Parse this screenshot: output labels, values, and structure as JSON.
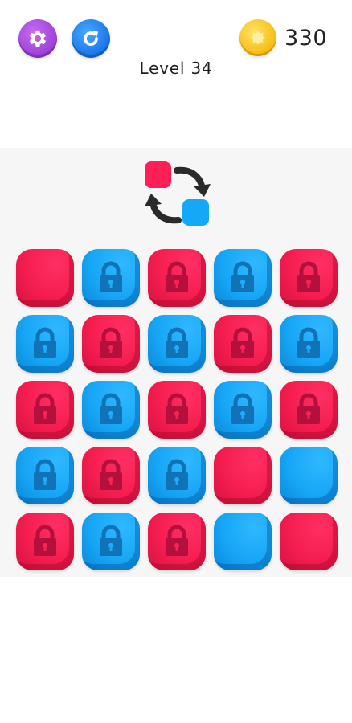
{
  "header": {
    "settings_icon": "gear-icon",
    "restart_icon": "restart-icon",
    "coin_icon": "coin-icon",
    "coins": "330",
    "level_text": "Level 34"
  },
  "hint": {
    "icon": "swap-arrows-icon",
    "from_color": "#ff1f55",
    "to_color": "#14a9f7"
  },
  "colors": {
    "red": "#f51d50",
    "blue": "#17a6f6",
    "settings_button": "#9b3fd6",
    "restart_button": "#1a73e8",
    "coin": "#f7c21b"
  },
  "board": {
    "rows": 5,
    "cols": 5,
    "tiles": [
      {
        "color": "red",
        "locked": false
      },
      {
        "color": "blue",
        "locked": true
      },
      {
        "color": "red",
        "locked": true
      },
      {
        "color": "blue",
        "locked": true
      },
      {
        "color": "red",
        "locked": true
      },
      {
        "color": "blue",
        "locked": true
      },
      {
        "color": "red",
        "locked": true
      },
      {
        "color": "blue",
        "locked": true
      },
      {
        "color": "red",
        "locked": true
      },
      {
        "color": "blue",
        "locked": true
      },
      {
        "color": "red",
        "locked": true
      },
      {
        "color": "blue",
        "locked": true
      },
      {
        "color": "red",
        "locked": true
      },
      {
        "color": "blue",
        "locked": true
      },
      {
        "color": "red",
        "locked": true
      },
      {
        "color": "blue",
        "locked": true
      },
      {
        "color": "red",
        "locked": true
      },
      {
        "color": "blue",
        "locked": true
      },
      {
        "color": "red",
        "locked": false
      },
      {
        "color": "blue",
        "locked": false
      },
      {
        "color": "red",
        "locked": true
      },
      {
        "color": "blue",
        "locked": true
      },
      {
        "color": "red",
        "locked": true
      },
      {
        "color": "blue",
        "locked": false
      },
      {
        "color": "red",
        "locked": false
      }
    ]
  }
}
